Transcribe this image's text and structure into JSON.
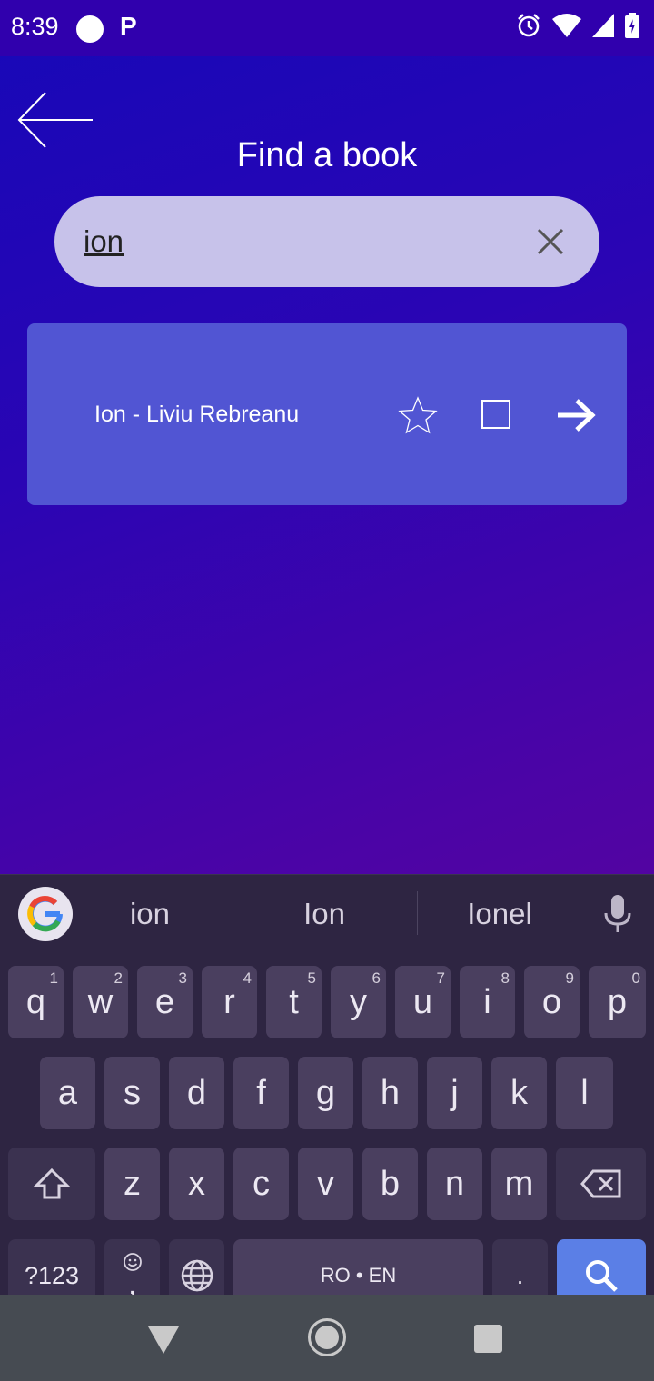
{
  "status_bar": {
    "time": "8:39",
    "notification_icon": "P",
    "icons": [
      "alarm-icon",
      "wifi-icon",
      "signal-icon",
      "battery-icon"
    ]
  },
  "header": {
    "title": "Find a book"
  },
  "search": {
    "value": "ion",
    "placeholder": ""
  },
  "results": [
    {
      "title": "Ion - Liviu Rebreanu"
    }
  ],
  "keyboard": {
    "suggestions": [
      "ion",
      "Ion",
      "Ionel"
    ],
    "row1": [
      {
        "k": "q",
        "h": "1"
      },
      {
        "k": "w",
        "h": "2"
      },
      {
        "k": "e",
        "h": "3"
      },
      {
        "k": "r",
        "h": "4"
      },
      {
        "k": "t",
        "h": "5"
      },
      {
        "k": "y",
        "h": "6"
      },
      {
        "k": "u",
        "h": "7"
      },
      {
        "k": "i",
        "h": "8"
      },
      {
        "k": "o",
        "h": "9"
      },
      {
        "k": "p",
        "h": "0"
      }
    ],
    "row2": [
      "a",
      "s",
      "d",
      "f",
      "g",
      "h",
      "j",
      "k",
      "l"
    ],
    "row3": [
      "z",
      "x",
      "c",
      "v",
      "b",
      "n",
      "m"
    ],
    "symbols_label": "?123",
    "comma_label": ",",
    "space_label": "RO • EN",
    "period_label": "."
  },
  "colors": {
    "accent_cursor": "#21c3b8",
    "card": "#5155d3",
    "search_key": "#5b7fe6"
  }
}
